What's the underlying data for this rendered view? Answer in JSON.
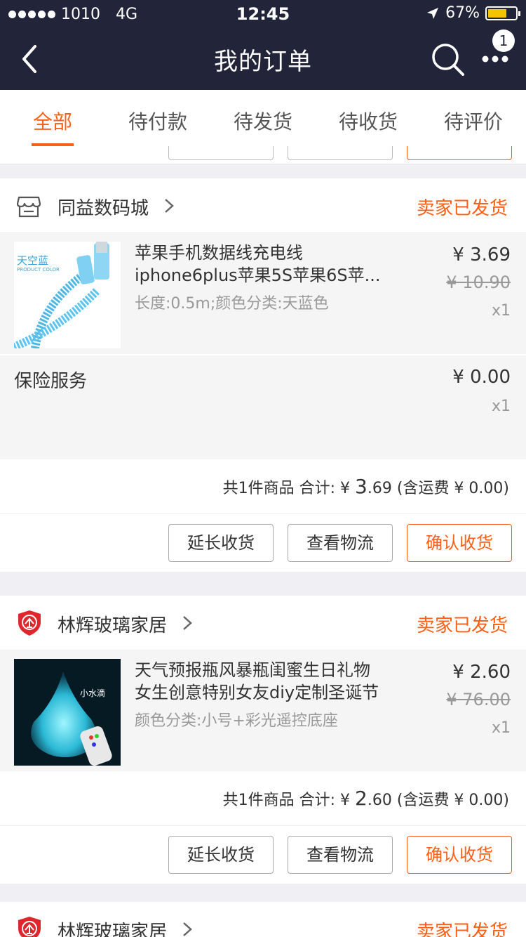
{
  "status_bar": {
    "carrier": "1010",
    "network": "4G",
    "time": "12:45",
    "battery": "67%",
    "battery_color": "#f5c400"
  },
  "nav": {
    "title": "我的订单",
    "badge": "1",
    "back_icon": "chevron-left-icon",
    "search_icon": "search-icon",
    "more_icon": "more-dots-icon"
  },
  "tabs": [
    {
      "label": "全部",
      "active": true
    },
    {
      "label": "待付款"
    },
    {
      "label": "待发货"
    },
    {
      "label": "待收货"
    },
    {
      "label": "待评价"
    }
  ],
  "colors": {
    "accent": "#ff5f15",
    "topbar": "#22253a"
  },
  "orders": [
    {
      "shop": "同益数码城",
      "status": "卖家已发货",
      "item": {
        "title_line1": "苹果手机数据线充电线",
        "title_line2": "iphone6plus苹果5S苹果6S苹...",
        "sku": "长度:0.5m;颜色分类:天蓝色",
        "price": "¥ 3.69",
        "original_price": "¥ 10.90",
        "qty": "x1",
        "thumb_label": "天空蓝",
        "thumb_sub": "PRODUCT COLOR"
      },
      "service": {
        "name": "保险服务",
        "price": "¥ 0.00",
        "qty": "x1"
      },
      "summary": {
        "prefix": "共1件商品 合计: ¥ ",
        "big": "3",
        "rest": ".69 (含运费 ¥ 0.00)"
      },
      "buttons": {
        "extend": "延长收货",
        "logistics": "查看物流",
        "confirm": "确认收货"
      }
    },
    {
      "shop": "林辉玻璃家居",
      "status": "卖家已发货",
      "item": {
        "title_line1": "天气预报瓶风暴瓶闺蜜生日礼物",
        "title_line2": "女生创意特别女友diy定制圣诞节",
        "sku": "颜色分类:小号+彩光遥控底座",
        "price": "¥ 2.60",
        "original_price": "¥ 76.00",
        "qty": "x1",
        "thumb_label": "小水滴"
      },
      "summary": {
        "prefix": "共1件商品 合计: ¥ ",
        "big": "2",
        "rest": ".60 (含运费 ¥ 0.00)"
      },
      "buttons": {
        "extend": "延长收货",
        "logistics": "查看物流",
        "confirm": "确认收货"
      }
    },
    {
      "shop": "林辉玻璃家居",
      "status": "卖家已发货"
    }
  ]
}
